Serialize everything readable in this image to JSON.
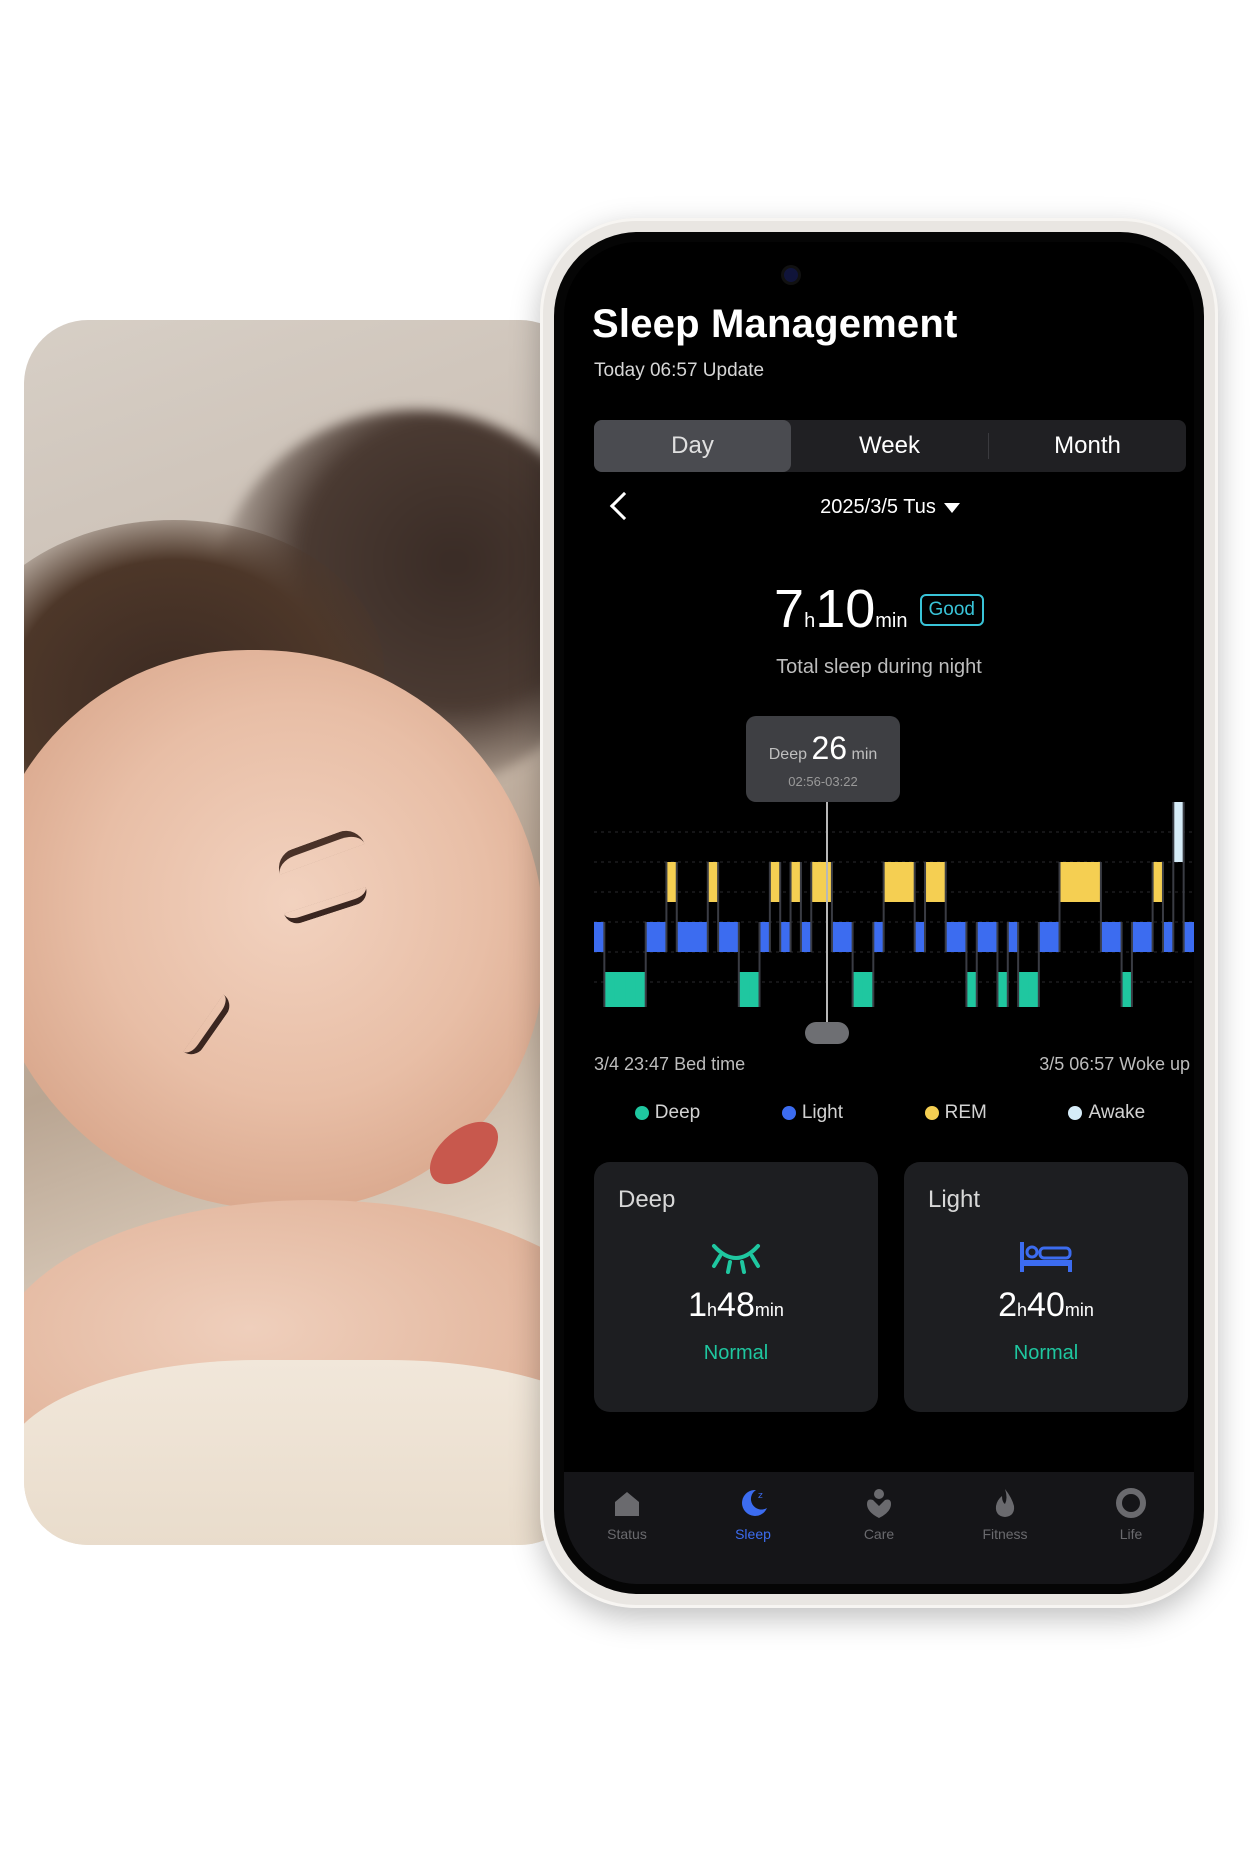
{
  "app": {
    "title": "Sleep Management",
    "subtitle": "Today 06:57 Update"
  },
  "tabs": [
    {
      "label": "Day",
      "active": true
    },
    {
      "label": "Week",
      "active": false
    },
    {
      "label": "Month",
      "active": false
    }
  ],
  "date": {
    "label": "2025/3/5 Tus"
  },
  "total_sleep": {
    "hours": "7",
    "hours_unit": "h",
    "minutes": "10",
    "minutes_unit": "min",
    "badge": "Good",
    "label": "Total sleep during night"
  },
  "tooltip": {
    "stage": "Deep",
    "value": "26",
    "unit": "min",
    "range": "02:56-03:22"
  },
  "times": {
    "bed": "3/4 23:47 Bed time",
    "wake": "3/5 06:57 Woke up"
  },
  "legend": [
    {
      "label": "Deep",
      "color": "#1fc7a0"
    },
    {
      "label": "Light",
      "color": "#3c6cf0"
    },
    {
      "label": "REM",
      "color": "#f5cf52"
    },
    {
      "label": "Awake",
      "color": "#d6ecf8"
    }
  ],
  "cards": {
    "deep": {
      "title": "Deep",
      "icon": "closed-eye-icon",
      "hours": "1",
      "hours_unit": "h",
      "minutes": "48",
      "minutes_unit": "min",
      "status": "Normal"
    },
    "light": {
      "title": "Light",
      "icon": "bed-icon",
      "hours": "2",
      "hours_unit": "h",
      "minutes": "40",
      "minutes_unit": "min",
      "status": "Normal"
    }
  },
  "nav": [
    {
      "label": "Status",
      "icon": "home-icon",
      "active": false
    },
    {
      "label": "Sleep",
      "icon": "moon-icon",
      "active": true
    },
    {
      "label": "Care",
      "icon": "heart-hand-icon",
      "active": false
    },
    {
      "label": "Fitness",
      "icon": "flame-icon",
      "active": false
    },
    {
      "label": "Life",
      "icon": "ring-icon",
      "active": false
    }
  ],
  "colors": {
    "deep": "#1fc7a0",
    "light": "#3c6cf0",
    "rem": "#f5cf52",
    "awake": "#d6ecf8",
    "accent": "#39c4d8"
  },
  "sleep_stages": [
    "light",
    "deep",
    "deep",
    "deep",
    "deep",
    "light",
    "light",
    "rem",
    "light",
    "light",
    "light",
    "rem",
    "light",
    "light",
    "deep",
    "deep",
    "light",
    "rem",
    "light",
    "rem",
    "light",
    "rem",
    "rem",
    "light",
    "light",
    "deep",
    "deep",
    "light",
    "rem",
    "rem",
    "rem",
    "light",
    "rem",
    "rem",
    "light",
    "light",
    "deep",
    "light",
    "light",
    "deep",
    "light",
    "deep",
    "deep",
    "light",
    "light",
    "rem",
    "rem",
    "rem",
    "rem",
    "light",
    "light",
    "deep",
    "light",
    "light",
    "rem",
    "light",
    "awake",
    "light"
  ]
}
